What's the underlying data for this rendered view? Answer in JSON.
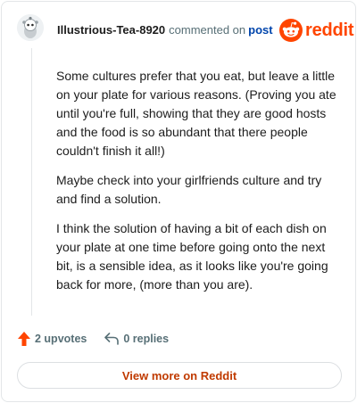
{
  "comment": {
    "username": "Illustrious-Tea-8920",
    "action": "commented on",
    "post_link": "post",
    "paragraphs": [
      "Some cultures prefer that you eat, but leave a little on your plate for various reasons. (Proving you ate until you're full, showing that they are good hosts and the food is so abundant that there people couldn't finish it all!)",
      "Maybe check into your girlfriends culture and try and find a solution.",
      "I think the solution of having a bit of each dish on your plate at one time before going onto the next bit, is a sensible idea, as it looks like you're going back for more, (more than you are)."
    ],
    "upvotes_label": "2 upvotes",
    "replies_label": "0 replies"
  },
  "brand": {
    "wordmark": "reddit",
    "icon": "reddit-snoo-icon",
    "color": "#ff4500"
  },
  "view_more_label": "View more on Reddit",
  "colors": {
    "upvote": "#ff4500",
    "link": "#0045ac",
    "view_more": "#c03a00",
    "meta": "#576f76"
  }
}
